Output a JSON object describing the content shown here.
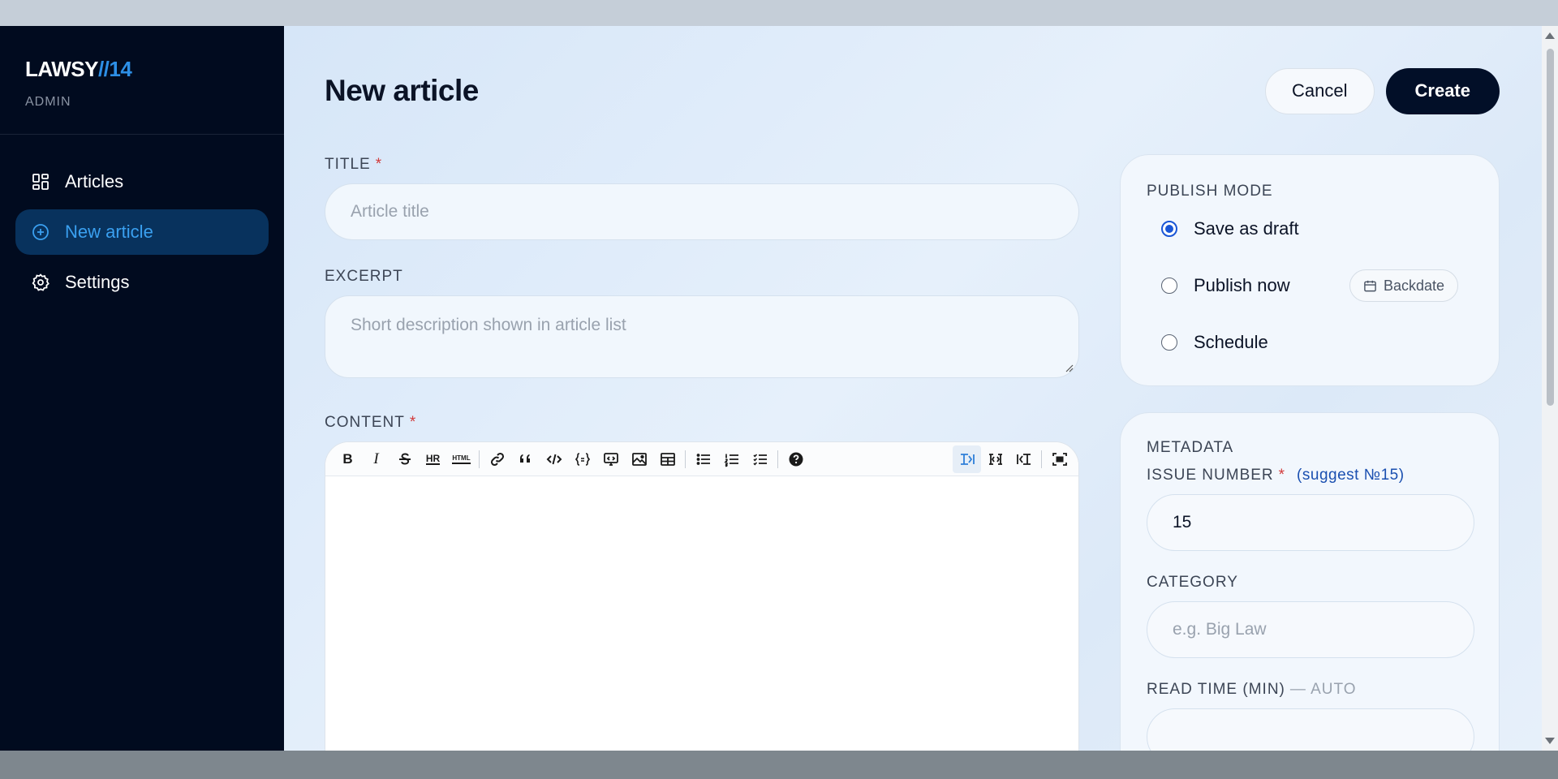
{
  "brand": {
    "name_main": "LAWSY",
    "name_accent": "//14",
    "subtitle": "ADMIN"
  },
  "nav": {
    "items": [
      {
        "label": "Articles",
        "icon": "grid-icon",
        "active": false
      },
      {
        "label": "New article",
        "icon": "plus-circle-icon",
        "active": true
      },
      {
        "label": "Settings",
        "icon": "gear-icon",
        "active": false
      }
    ]
  },
  "header": {
    "title": "New article",
    "cancel_label": "Cancel",
    "create_label": "Create"
  },
  "form": {
    "title_label": "TITLE",
    "title_placeholder": "Article title",
    "excerpt_label": "EXCERPT",
    "excerpt_placeholder": "Short description shown in article list",
    "content_label": "CONTENT",
    "required_mark": "*"
  },
  "toolbar": {
    "buttons": [
      "bold",
      "italic",
      "strikethrough",
      "horizontal-rule",
      "html",
      "link",
      "quote",
      "code",
      "code-block",
      "preview",
      "image",
      "table",
      "bullet-list",
      "numbered-list",
      "task-list",
      "help"
    ],
    "bold": "B",
    "italic": "I",
    "hr": "HR",
    "html": "HTML"
  },
  "publish": {
    "title": "PUBLISH MODE",
    "options": [
      {
        "label": "Save as draft",
        "checked": true
      },
      {
        "label": "Publish now",
        "checked": false
      },
      {
        "label": "Schedule",
        "checked": false
      }
    ],
    "backdate_label": "Backdate"
  },
  "metadata": {
    "title": "METADATA",
    "issue_label": "ISSUE NUMBER",
    "issue_suggest": "(suggest №15)",
    "issue_value": "15",
    "category_label": "CATEGORY",
    "category_placeholder": "e.g. Big Law",
    "readtime_label": "READ TIME (MIN)",
    "readtime_suffix": "— AUTO"
  },
  "colors": {
    "sidebar_bg": "#010b1f",
    "accent": "#2d8fe6",
    "primary": "#020f28",
    "required": "#d23a3a"
  }
}
